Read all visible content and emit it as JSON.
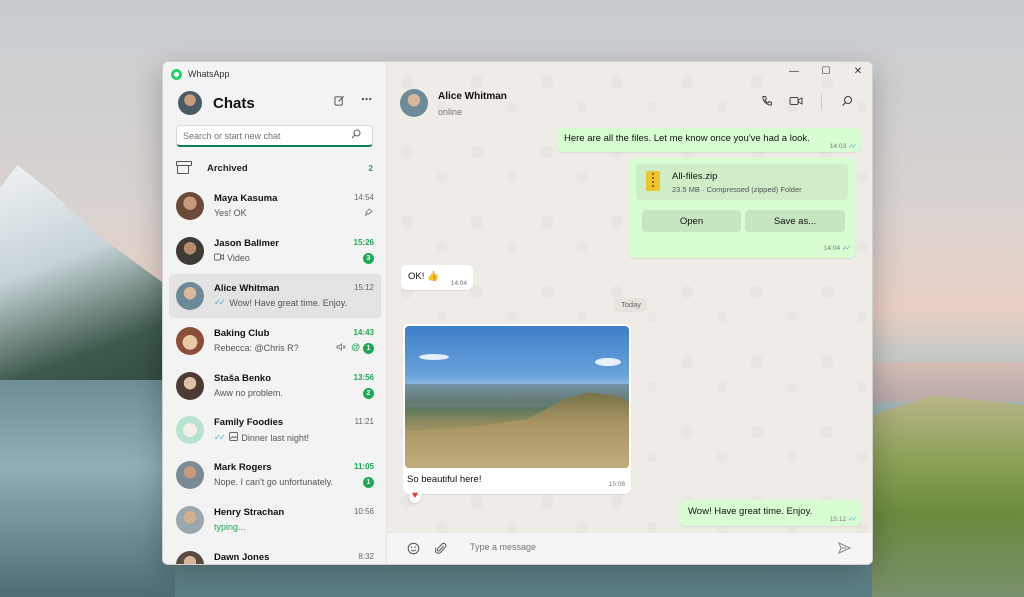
{
  "app": {
    "title": "WhatsApp",
    "accent": "#1fa855",
    "bubble_out": "#d9fdd3"
  },
  "window_controls": {
    "minimize": "—",
    "maximize": "☐",
    "close": "✕"
  },
  "sidebar": {
    "title": "Chats",
    "new_chat_icon": "compose-icon",
    "more_icon": "⋯",
    "search": {
      "placeholder": "Search or start new chat",
      "value": ""
    },
    "archived": {
      "label": "Archived",
      "count": "2"
    },
    "chats": [
      {
        "name": "Maya Kasuma",
        "time": "14:54",
        "preview": "Yes! OK",
        "pinned": true
      },
      {
        "name": "Jason Ballmer",
        "time": "15:26",
        "preview": "Video",
        "unread": "3",
        "media_icon": "video-icon"
      },
      {
        "name": "Alice Whitman",
        "time": "15:12",
        "preview": "Wow! Have great time. Enjoy.",
        "active": true,
        "ticks": true
      },
      {
        "name": "Baking Club",
        "time": "14:43",
        "preview": "Rebecca: @Chris R?",
        "unread": "1",
        "muted": true,
        "mention": true
      },
      {
        "name": "Staša Benko",
        "time": "13:56",
        "preview": "Aww no problem.",
        "unread": "2"
      },
      {
        "name": "Family Foodies",
        "time": "11:21",
        "preview": "Dinner last night!",
        "ticks": true,
        "media_icon": "image-icon"
      },
      {
        "name": "Mark Rogers",
        "time": "11:05",
        "preview": "Nope. I can't go unfortunately.",
        "unread": "1"
      },
      {
        "name": "Henry Strachan",
        "time": "10:56",
        "preview": "typing...",
        "typing": true
      },
      {
        "name": "Dawn Jones",
        "time": "8:32",
        "preview": ""
      }
    ]
  },
  "conversation": {
    "contact_name": "Alice Whitman",
    "status": "online",
    "messages": {
      "m1": {
        "text": "Here are all the files. Let me know once you've had a look.",
        "time": "14:03"
      },
      "file": {
        "name": "All-files.zip",
        "meta": "23.5 MB · Compressed (zipped) Folder",
        "open_label": "Open",
        "save_label": "Save as...",
        "time": "14:04"
      },
      "m2": {
        "text": "OK! 👍",
        "time": "14:04"
      },
      "day": "Today",
      "photo": {
        "caption": "So beautiful here!",
        "time": "15:06",
        "reaction": "♥"
      },
      "m3": {
        "text": "Wow! Have great time. Enjoy.",
        "time": "15:12"
      }
    },
    "composer": {
      "placeholder": "Type a message",
      "value": ""
    }
  }
}
